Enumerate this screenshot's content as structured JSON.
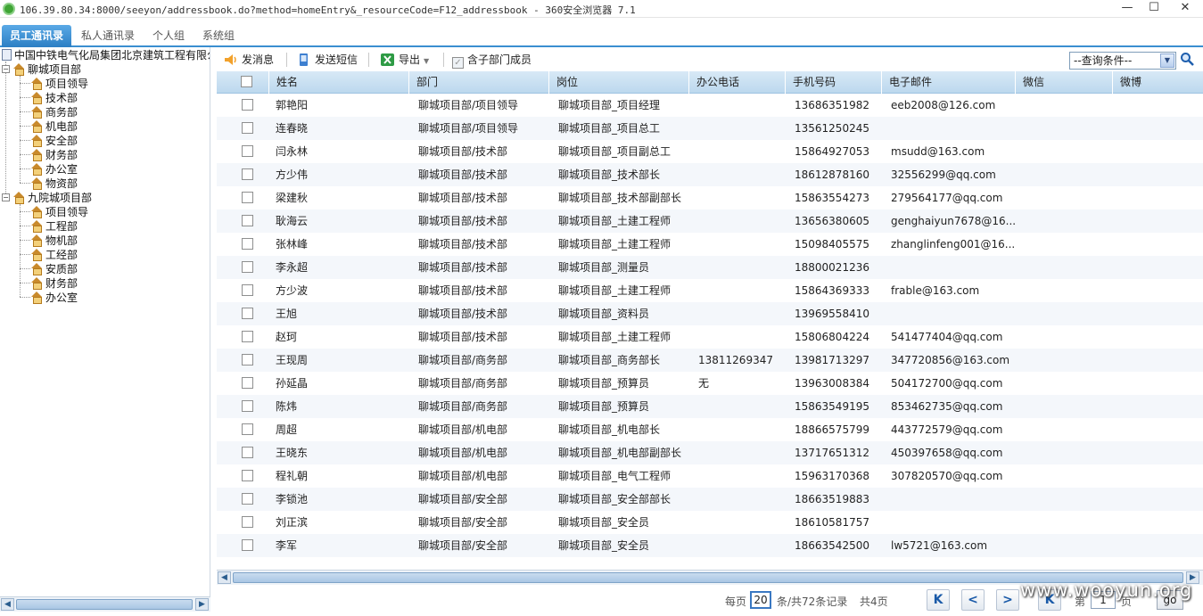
{
  "window": {
    "title": "106.39.80.34:8000/seeyon/addressbook.do?method=homeEntry&_resourceCode=F12_addressbook - 360安全浏览器 7.1",
    "minimize": "—",
    "maximize": "☐",
    "close": "✕"
  },
  "tabs": [
    {
      "label": "员工通讯录",
      "active": true
    },
    {
      "label": "私人通讯录",
      "active": false
    },
    {
      "label": "个人组",
      "active": false
    },
    {
      "label": "系统组",
      "active": false
    }
  ],
  "tree": {
    "root": "中国中铁电气化局集团北京建筑工程有限公司",
    "groups": [
      {
        "name": "聊城项目部",
        "expander": "−",
        "children": [
          "项目领导",
          "技术部",
          "商务部",
          "机电部",
          "安全部",
          "财务部",
          "办公室",
          "物资部"
        ]
      },
      {
        "name": "九院城项目部",
        "expander": "−",
        "children": [
          "项目领导",
          "工程部",
          "物机部",
          "工经部",
          "安质部",
          "财务部",
          "办公室"
        ]
      }
    ]
  },
  "toolbar": {
    "send_message": "发消息",
    "send_sms": "发送短信",
    "export": "导出",
    "include_sub": "含子部门成员",
    "query_placeholder": "--查询条件--"
  },
  "grid": {
    "columns": [
      "姓名",
      "部门",
      "岗位",
      "办公电话",
      "手机号码",
      "电子邮件",
      "微信",
      "微博"
    ],
    "rows": [
      [
        "郭艳阳",
        "聊城项目部/项目领导",
        "聊城项目部_项目经理",
        "",
        "13686351982",
        "eeb2008@126.com"
      ],
      [
        "连春晓",
        "聊城项目部/项目领导",
        "聊城项目部_项目总工",
        "",
        "13561250245",
        ""
      ],
      [
        "闫永林",
        "聊城项目部/技术部",
        "聊城项目部_项目副总工",
        "",
        "15864927053",
        "msudd@163.com"
      ],
      [
        "方少伟",
        "聊城项目部/技术部",
        "聊城项目部_技术部长",
        "",
        "18612878160",
        "32556299@qq.com"
      ],
      [
        "梁建秋",
        "聊城项目部/技术部",
        "聊城项目部_技术部副部长",
        "",
        "15863554273",
        "279564177@qq.com"
      ],
      [
        "耿海云",
        "聊城项目部/技术部",
        "聊城项目部_土建工程师",
        "",
        "13656380605",
        "genghaiyun7678@16..."
      ],
      [
        "张林峰",
        "聊城项目部/技术部",
        "聊城项目部_土建工程师",
        "",
        "15098405575",
        "zhanglinfeng001@16..."
      ],
      [
        "李永超",
        "聊城项目部/技术部",
        "聊城项目部_测量员",
        "",
        "18800021236",
        ""
      ],
      [
        "方少波",
        "聊城项目部/技术部",
        "聊城项目部_土建工程师",
        "",
        "15864369333",
        "frable@163.com"
      ],
      [
        "王旭",
        "聊城项目部/技术部",
        "聊城项目部_资料员",
        "",
        "13969558410",
        ""
      ],
      [
        "赵珂",
        "聊城项目部/技术部",
        "聊城项目部_土建工程师",
        "",
        "15806804224",
        "541477404@qq.com"
      ],
      [
        "王现周",
        "聊城项目部/商务部",
        "聊城项目部_商务部长",
        "13811269347",
        "13981713297",
        "347720856@163.com"
      ],
      [
        "孙延晶",
        "聊城项目部/商务部",
        "聊城项目部_预算员",
        "无",
        "13963008384",
        "504172700@qq.com"
      ],
      [
        "陈炜",
        "聊城项目部/商务部",
        "聊城项目部_预算员",
        "",
        "15863549195",
        "853462735@qq.com"
      ],
      [
        "周超",
        "聊城项目部/机电部",
        "聊城项目部_机电部长",
        "",
        "18866575799",
        "443772579@qq.com"
      ],
      [
        "王晓东",
        "聊城项目部/机电部",
        "聊城项目部_机电部副部长",
        "",
        "13717651312",
        "450397658@qq.com"
      ],
      [
        "程礼朝",
        "聊城项目部/机电部",
        "聊城项目部_电气工程师",
        "",
        "15963170368",
        "307820570@qq.com"
      ],
      [
        "李锁池",
        "聊城项目部/安全部",
        "聊城项目部_安全部部长",
        "",
        "18663519883",
        ""
      ],
      [
        "刘正滨",
        "聊城项目部/安全部",
        "聊城项目部_安全员",
        "",
        "18610581757",
        ""
      ],
      [
        "李军",
        "聊城项目部/安全部",
        "聊城项目部_安全员",
        "",
        "18663542500",
        "lw5721@163.com"
      ]
    ]
  },
  "pager": {
    "per_page_label": "每页",
    "page_size": "20",
    "records_text": "条/共72条记录",
    "total_pages": "共4页",
    "page_prefix": "第",
    "current_page": "1",
    "page_suffix": "页",
    "go": "go",
    "first": "K",
    "prev": "<",
    "next": ">",
    "last": "K"
  },
  "watermark": "www.wooyun.org",
  "colors": {
    "accent": "#2c7fc4",
    "header_bg": "#c8e0f2",
    "row_alt": "#f4f7fb"
  }
}
